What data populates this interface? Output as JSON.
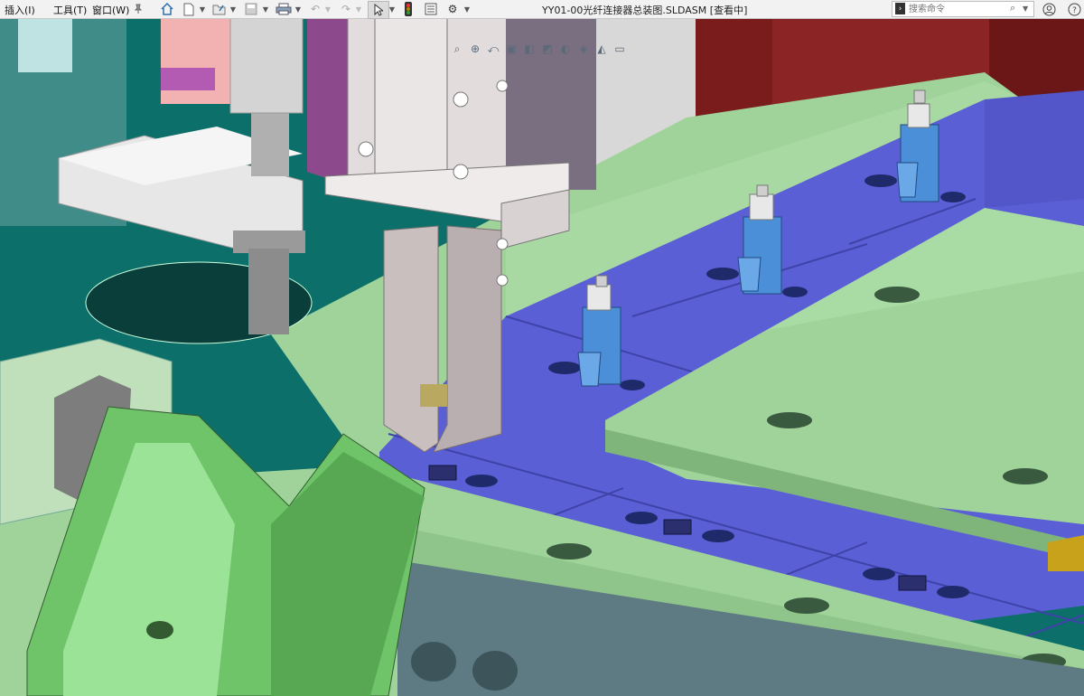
{
  "menu": {
    "insert": "插入(I)",
    "tools": "工具(T)",
    "window": "窗口(W)"
  },
  "toolbar_icons": [
    "pin-icon",
    "home-icon",
    "new-document-icon",
    "open-file-icon",
    "save-icon",
    "print-icon",
    "undo-icon",
    "redo-icon",
    "select-pointer-icon",
    "traffic-light-icon",
    "file-properties-icon",
    "options-gear-icon"
  ],
  "document_title": "YY01-00光纤连接器总装图.SLDASM [查看中]",
  "search": {
    "placeholder": "搜索命令"
  },
  "heads_up_toolbar": [
    "zoom-to-fit-icon",
    "zoom-area-icon",
    "previous-view-icon",
    "section-view-icon",
    "view-orientation-icon",
    "display-style-icon",
    "hide-show-icon",
    "edit-appearance-icon",
    "apply-scene-icon",
    "view-settings-icon"
  ],
  "colors": {
    "teal_frame": "#0e6e69",
    "green_plate": "#9fd39a",
    "blue_tray": "#5b5fd6",
    "maroon_block": "#7a1c1c",
    "gripper_metal": "#c9bfbf",
    "connector_blue": "#4a8fd8",
    "grid_plate": "#5e7a82"
  }
}
